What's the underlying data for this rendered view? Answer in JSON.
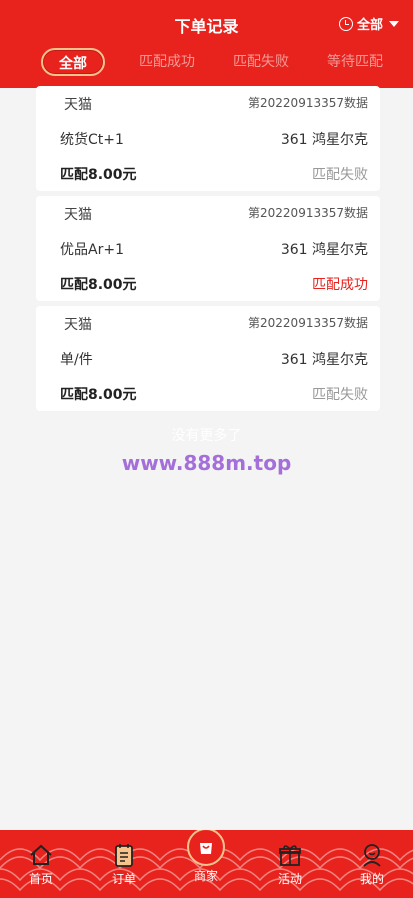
{
  "header": {
    "title": "下单记录",
    "filter_label": "全部"
  },
  "tabs": [
    {
      "label": "全部"
    },
    {
      "label": "匹配成功"
    },
    {
      "label": "匹配失败"
    },
    {
      "label": "等待匹配"
    }
  ],
  "orders": [
    {
      "shop": "天猫",
      "order_no": "第20220913357数据",
      "product": "统货Ct+1",
      "merchant": "361 鸿星尔克",
      "amount": "匹配8.00元",
      "status": "匹配失败"
    },
    {
      "shop": "天猫",
      "order_no": "第20220913357数据",
      "product": "优品Ar+1",
      "merchant": "361 鸿星尔克",
      "amount": "匹配8.00元",
      "status": "匹配成功"
    },
    {
      "shop": "天猫",
      "order_no": "第20220913357数据",
      "product": "单/件",
      "merchant": "361 鸿星尔克",
      "amount": "匹配8.00元",
      "status": "匹配失败"
    }
  ],
  "list_footer": "没有更多了",
  "watermark": "www.888m.top",
  "tabbar": [
    {
      "label": "首页",
      "icon": "home-icon"
    },
    {
      "label": "订单",
      "icon": "order-icon"
    },
    {
      "label": "商家",
      "icon": "shopping-bag-icon"
    },
    {
      "label": "活动",
      "icon": "gift-icon"
    },
    {
      "label": "我的",
      "icon": "user-icon"
    }
  ],
  "colors": {
    "brand_red": "#e8231e",
    "gold": "#f6c38d",
    "fail_gray": "#999999",
    "watermark_purple": "#a46fd8"
  }
}
